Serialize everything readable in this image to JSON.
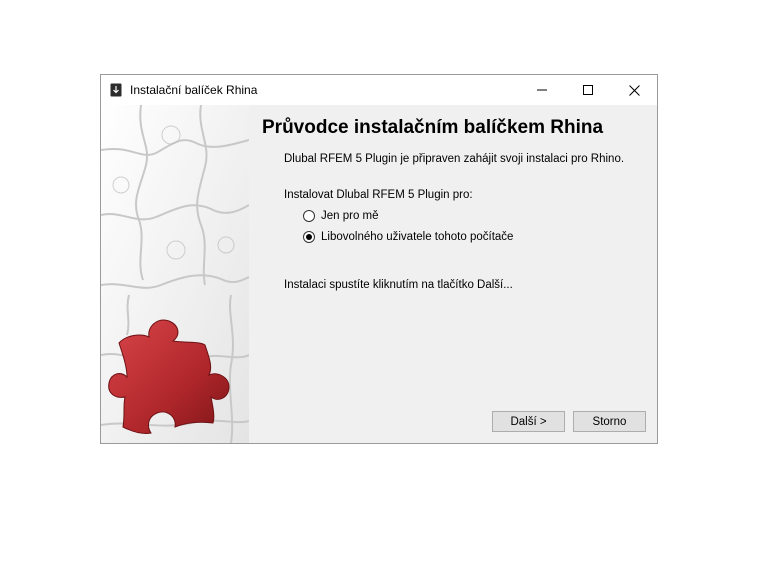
{
  "window": {
    "title": "Instalační balíček Rhina",
    "app_icon": "installer-icon",
    "controls": {
      "minimize_icon": "minimize-icon",
      "maximize_icon": "maximize-icon",
      "close_icon": "close-icon"
    }
  },
  "side_image": {
    "icon": "puzzle-image"
  },
  "main": {
    "heading": "Průvodce instalačním balíčkem Rhina",
    "ready_text": "Dlubal RFEM 5 Plugin je připraven zahájit svoji instalaci pro Rhino.",
    "install_for_label": "Instalovat Dlubal RFEM 5 Plugin pro:",
    "options": [
      {
        "label": "Jen pro mě",
        "checked": false
      },
      {
        "label": "Libovolného uživatele tohoto počítače",
        "checked": true
      }
    ],
    "start_text": "Instalaci spustíte kliknutím na tlačítko Další..."
  },
  "buttons": {
    "next": "Další >",
    "cancel": "Storno"
  },
  "colors": {
    "puzzle_red": "#b0272b",
    "button_bg": "#e1e1e1",
    "content_bg": "#f0f0f0"
  }
}
